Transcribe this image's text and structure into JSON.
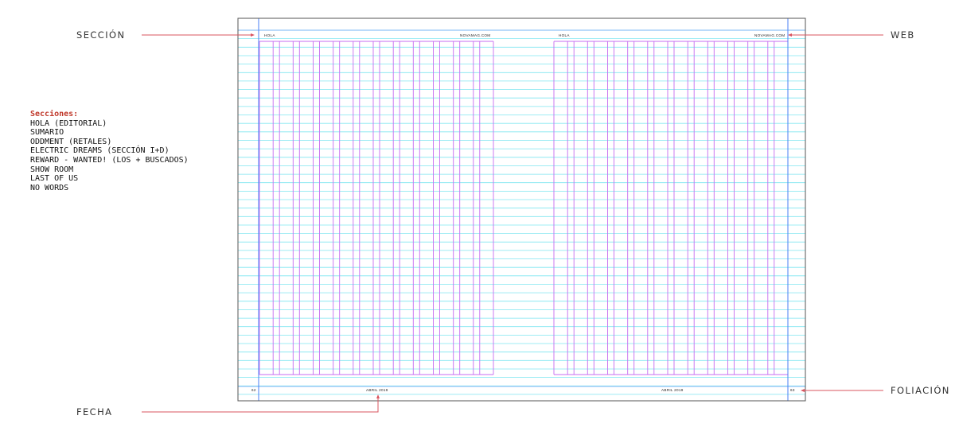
{
  "callouts": {
    "section": "SECCIÓN",
    "web": "WEB",
    "date": "FECHA",
    "folio": "FOLIACIÓN"
  },
  "sections_list": {
    "title": "Secciones:",
    "items": [
      "HOLA (EDITORIAL)",
      "SUMARIO",
      "ODDMENT (RETALES)",
      "ELECTRIC DREAMS (SECCIÓN I+D)",
      "REWARD - WANTED! (LOS + BUSCADOS)",
      "SHOW ROOM",
      "LAST OF US",
      "NO WORDS"
    ]
  },
  "spread": {
    "left_header_section": "HOLA",
    "left_header_web": "NOVAMAG.COM",
    "right_header_section": "HOLA",
    "right_header_web": "NOVAMAG.COM",
    "left_page_number": "62",
    "right_page_number": "63",
    "left_footer_date": "ABRIL 2019",
    "right_footer_date": "ABRIL 2019"
  },
  "colors": {
    "baseline_grid": "#7fe6f0",
    "column_guides": "#c76cf0",
    "margin_guides": "#4a7ff5",
    "callout_lines": "#d9545f",
    "page_border": "#555555"
  }
}
